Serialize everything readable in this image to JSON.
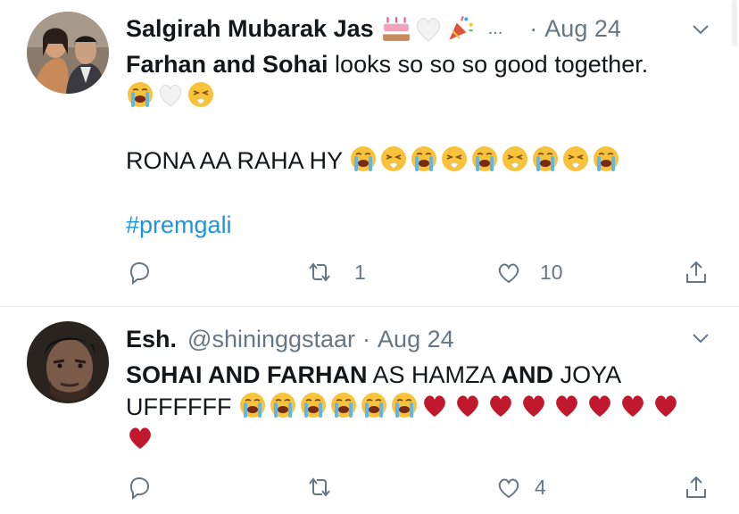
{
  "tweets": [
    {
      "display_name": "Salgirah Mubarak Jas",
      "name_emojis": [
        "birthday-cake-emoji",
        "white-heart-emoji",
        "party-popper-emoji"
      ],
      "ellipsis": "...",
      "dot": "·",
      "date": "Aug 24",
      "line1_bold1": "Farhan and Sohai",
      "line1_rest": " looks so so so good together.",
      "line2_emojis": [
        "loudly-crying-emoji",
        "white-heart-emoji",
        "sneezing-face-emoji"
      ],
      "line3_text": "RONA AA RAHA HY ",
      "line3_emojis": [
        "loudly-crying-emoji",
        "sneezing-face-emoji",
        "loudly-crying-emoji",
        "sneezing-face-emoji",
        "loudly-crying-emoji",
        "sneezing-face-emoji",
        "loudly-crying-emoji",
        "sneezing-face-emoji",
        "loudly-crying-emoji"
      ],
      "hashtag": "#premgali",
      "actions": {
        "reply_count": "",
        "retweet_count": "1",
        "like_count": "10"
      }
    },
    {
      "display_name": "Esh.",
      "handle": "@shininggstaar",
      "dot": "·",
      "date": "Aug 24",
      "line1_bold1": "SOHAI AND FARHAN",
      "line1_mid": " AS HAMZA ",
      "line1_bold2": "AND",
      "line1_rest": " JOYA",
      "line2_text": "UFFFFFF ",
      "line2_emojis": [
        "loudly-crying-emoji",
        "loudly-crying-emoji",
        "loudly-crying-emoji",
        "loudly-crying-emoji",
        "loudly-crying-emoji",
        "loudly-crying-emoji",
        "red-heart-emoji",
        "red-heart-emoji",
        "red-heart-emoji",
        "red-heart-emoji",
        "red-heart-emoji",
        "red-heart-emoji",
        "red-heart-emoji",
        "red-heart-emoji"
      ],
      "line3_emojis": [
        "red-heart-emoji"
      ],
      "actions": {
        "reply_count": "",
        "retweet_count": "",
        "like_count": "4"
      }
    }
  ],
  "colors": {
    "text": "#14171a",
    "muted": "#657786",
    "link": "#1b95e0",
    "divider": "#e1e8ed"
  }
}
